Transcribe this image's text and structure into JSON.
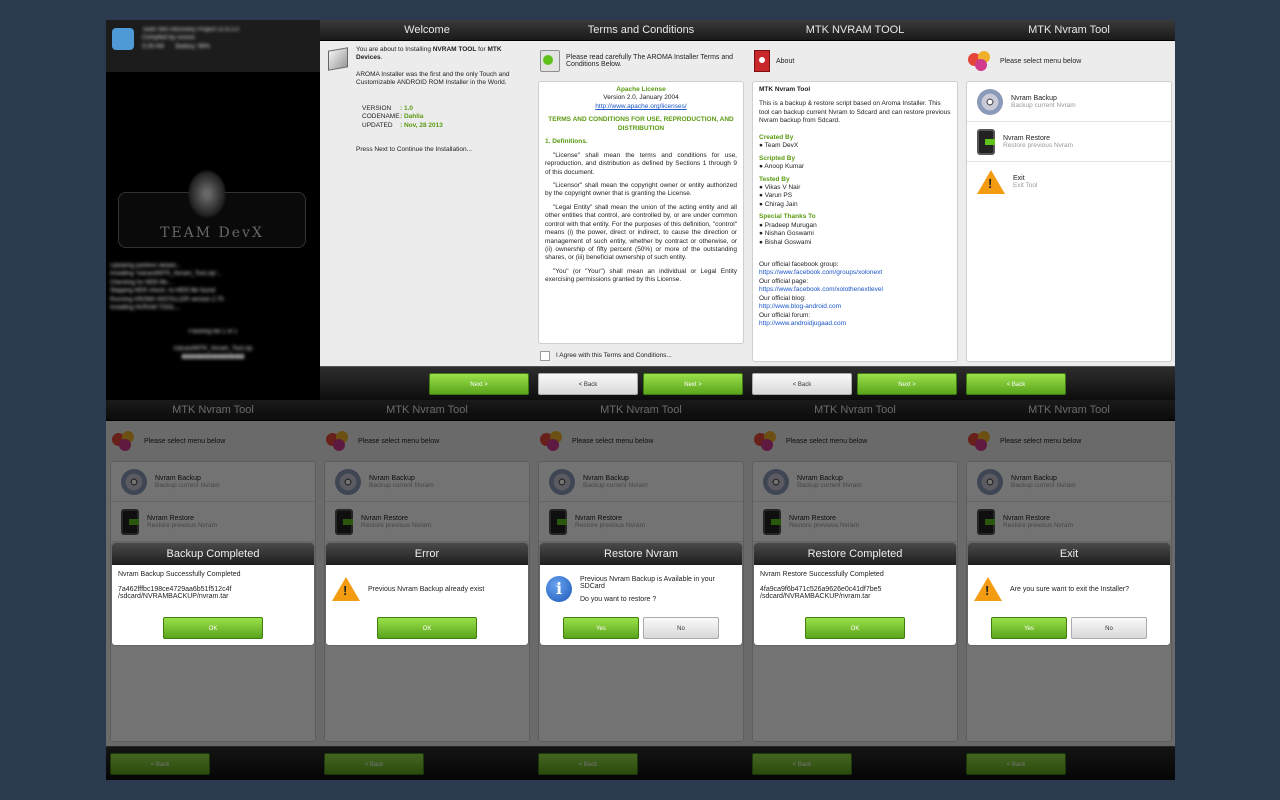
{
  "welcome": {
    "title": "Welcome",
    "intro_pre": "You are about to Installing ",
    "intro_bold": "NVRAM TOOL",
    "intro_mid": " for ",
    "intro_bold2": "MTK Devices",
    "intro_end": ".",
    "desc": "AROMA Installer was the first and the only Touch and Customizable ANDROID ROM Installer in the World.",
    "version_label": "VERSION",
    "version_value": ": 1.0",
    "codename_label": "CODENAME",
    "codename_value": ": Dahlia",
    "updated_label": "UPDATED",
    "updated_value": ": Nov, 28 2013",
    "press": "Press Next to Continue the Installation...",
    "next": "Next >"
  },
  "terms": {
    "title": "Terms and Conditions",
    "header": "Please read carefully The AROMA Installer Terms and Conditions Below.",
    "lic_title": "Apache License",
    "lic_version": "Version 2.0, January 2004",
    "lic_url": "http://www.apache.org/licenses/",
    "lic_heading": "TERMS AND CONDITIONS FOR USE, REPRODUCTION, AND DISTRIBUTION",
    "def_heading": "1. Definitions.",
    "p1": "\"License\" shall mean the terms and conditions for use, reproduction, and distribution as defined by Sections 1 through 9 of this document.",
    "p2": "\"Licensor\" shall mean the copyright owner or entity authorized by the copyright owner that is granting the License.",
    "p3": "\"Legal Entity\" shall mean the union of the acting entity and all other entities that control, are controlled by, or are under common control with that entity. For the purposes of this definition, \"control\" means (i) the power, direct or indirect, to cause the direction or management of such entity, whether by contract or otherwise, or (ii) ownership of fifty percent (50%) or more of the outstanding shares, or (iii) beneficial ownership of such entity.",
    "p4": "\"You\" (or \"Your\") shall mean an individual or Legal Entity exercising permissions granted by this License.",
    "agree": "I Agree with this Terms and Conditions...",
    "back": "< Back",
    "next": "Next >"
  },
  "about": {
    "title": "MTK NVRAM TOOL",
    "header": "About",
    "name": "MTK Nvram Tool",
    "desc": "This is a backup & restore script based on Aroma Installer. This tool can backup current Nvram to Sdcard and can restore previous Nvram backup from Sdcard.",
    "created_h": "Created By",
    "created": "● Team DevX",
    "scripted_h": "Scripted By",
    "scripted": "● Anoop Kumar",
    "tested_h": "Tested By",
    "tested": [
      "● Vikas V Nair",
      "● Varun PS",
      "● Chirag Jain"
    ],
    "thanks_h": "Special Thanks To",
    "thanks": [
      "● Pradeep Murugan",
      "● Nishan Goswami",
      "● Bishal Goswami"
    ],
    "fb_label": "Our official facebook group:",
    "fb_url": "https://www.facebook.com/groups/xolonext",
    "page_label": "Our official page:",
    "page_url": "https://www.facebook.com/xolothenextlevel",
    "blog_label": "Our official blog:",
    "blog_url": "http://www.blog-android.com",
    "forum_label": "Our official forum:",
    "forum_url": "http://www.androidjugaad.com",
    "back": "< Back",
    "next": "Next >"
  },
  "menu": {
    "title": "MTK Nvram Tool",
    "header": "Please select menu below",
    "items": [
      {
        "title": "Nvram Backup",
        "sub": "Backup current Nvram"
      },
      {
        "title": "Nvram Restore",
        "sub": "Restore previous Nvram"
      },
      {
        "title": "Exit",
        "sub": "Exit Tool"
      }
    ],
    "back": "< Back"
  },
  "dialogs": [
    {
      "title": "Backup Completed",
      "line1": "Nvram Backup Successfully Completed",
      "line2": "7a462fffbc198ce4729aa6b51f512c4f",
      "line3": "/sdcard/NVRAMBACKUP/nvram.tar",
      "ok": "OK"
    },
    {
      "title": "Error",
      "line1": "Previous Nvram Backup already exist",
      "ok": "OK"
    },
    {
      "title": "Restore Nvram",
      "line1": "Previous Nvram Backup is Available in your SDCard",
      "line2": "Do you want to restore ?",
      "yes": "Yes",
      "no": "No"
    },
    {
      "title": "Restore Completed",
      "line1": "Nvram Restore Successfully Completed",
      "line2": "4fa9ca9f6b471c526a9626e0c41df7be5",
      "line3": "/sdcard/NVRAMBACKUP/nvram.tar",
      "ok": "OK"
    },
    {
      "title": "Exit",
      "line1": "Are you sure want to exit the Installer?",
      "yes": "Yes",
      "no": "No"
    }
  ],
  "twrp": {
    "brand": "TEAM DevX"
  }
}
